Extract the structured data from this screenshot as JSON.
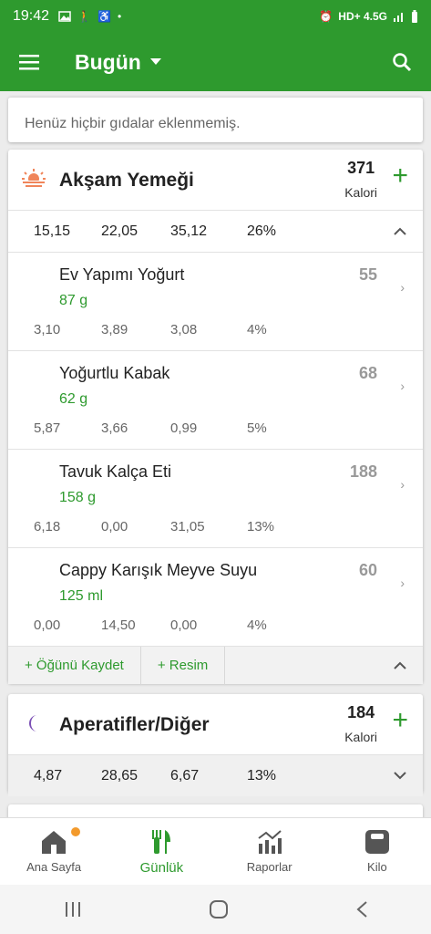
{
  "statusbar": {
    "time": "19:42",
    "network": "HD+ 4.5G"
  },
  "appbar": {
    "title": "Bugün"
  },
  "empty_message": "Henüz hiçbir gıdalar eklenmemiş.",
  "dinner": {
    "title": "Akşam Yemeği",
    "calories": "371",
    "cal_unit": "Kalori",
    "macros": [
      "15,15",
      "22,05",
      "35,12",
      "26%"
    ],
    "items": [
      {
        "name": "Ev Yapımı Yoğurt",
        "qty": "87  g",
        "cal": "55",
        "macros": [
          "3,10",
          "3,89",
          "3,08",
          "4%"
        ]
      },
      {
        "name": "Yoğurtlu Kabak",
        "qty": "62  g",
        "cal": "68",
        "macros": [
          "5,87",
          "3,66",
          "0,99",
          "5%"
        ]
      },
      {
        "name": "Tavuk Kalça Eti",
        "qty": "158  g",
        "cal": "188",
        "macros": [
          "6,18",
          "0,00",
          "31,05",
          "13%"
        ]
      },
      {
        "name": "Cappy Karışık Meyve Suyu",
        "qty": "125  ml",
        "cal": "60",
        "macros": [
          "0,00",
          "14,50",
          "0,00",
          "4%"
        ]
      }
    ],
    "actions": {
      "save": "+ Öğünü Kaydet",
      "photo": "+ Resim"
    }
  },
  "snacks": {
    "title": "Aperatifler/Diğer",
    "calories": "184",
    "cal_unit": "Kalori",
    "macros": [
      "4,87",
      "28,65",
      "6,67",
      "13%"
    ]
  },
  "bottomnav": {
    "items": [
      {
        "label": "Ana Sayfa",
        "icon": "home-icon"
      },
      {
        "label": "Günlük",
        "icon": "utensils-icon"
      },
      {
        "label": "Raporlar",
        "icon": "chart-icon"
      },
      {
        "label": "Kilo",
        "icon": "scale-icon"
      }
    ]
  },
  "colors": {
    "primary": "#2e9a2e",
    "badge": "#f39a2c",
    "moon": "#7b4fb5",
    "sunset": "#f0855a"
  }
}
